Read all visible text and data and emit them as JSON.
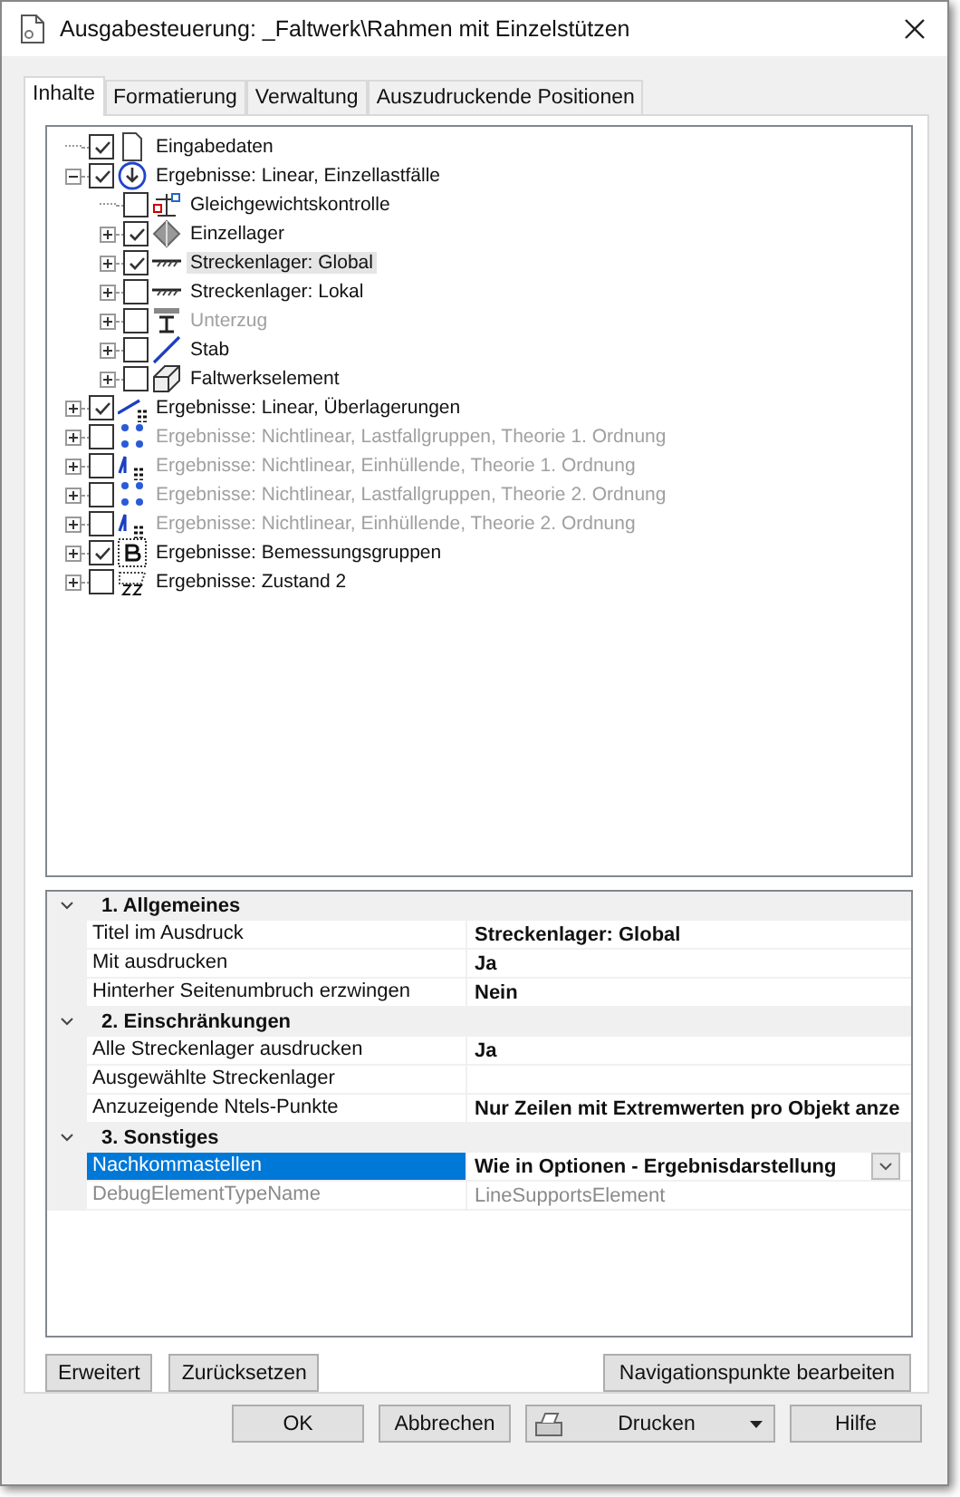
{
  "window": {
    "title": "Ausgabesteuerung: _Faltwerk\\Rahmen mit Einzelstützen"
  },
  "tabs": [
    {
      "label": "Inhalte",
      "selected": true
    },
    {
      "label": "Formatierung",
      "selected": false
    },
    {
      "label": "Verwaltung",
      "selected": false
    },
    {
      "label": "Auszudruckende Positionen",
      "selected": false
    }
  ],
  "tree": [
    {
      "label": "Eingabedaten",
      "kind": "document",
      "checked": true,
      "disabled": false,
      "selected": false
    },
    {
      "label": "Ergebnisse: Linear, Einzellastfälle",
      "kind": "result",
      "expanded": true,
      "checked": true,
      "disabled": false,
      "selected": false,
      "children": [
        {
          "label": "Gleichgewichtskontrolle",
          "kind": "balance",
          "checked": false,
          "disabled": false,
          "selected": false
        },
        {
          "label": "Einzellager",
          "kind": "support",
          "expanded": false,
          "checked": true,
          "disabled": false,
          "selected": false
        },
        {
          "label": "Streckenlager: Global",
          "kind": "linesupport",
          "expanded": false,
          "checked": true,
          "disabled": false,
          "selected": true
        },
        {
          "label": "Streckenlager: Lokal",
          "kind": "linesupport",
          "expanded": false,
          "checked": false,
          "disabled": false,
          "selected": false
        },
        {
          "label": "Unterzug",
          "kind": "beam",
          "expanded": false,
          "checked": false,
          "disabled": true,
          "selected": false
        },
        {
          "label": "Stab",
          "kind": "bar",
          "expanded": false,
          "checked": false,
          "disabled": false,
          "selected": false
        },
        {
          "label": "Faltwerkselement",
          "kind": "shell",
          "expanded": false,
          "checked": false,
          "disabled": false,
          "selected": false
        }
      ]
    },
    {
      "label": "Ergebnisse: Linear, Überlagerungen",
      "kind": "combination",
      "expanded": false,
      "checked": true,
      "disabled": false,
      "selected": false
    },
    {
      "label": "Ergebnisse: Nichtlinear, Lastfallgruppen, Theorie 1. Ordnung",
      "kind": "groups",
      "expanded": false,
      "checked": false,
      "disabled": true,
      "selected": false
    },
    {
      "label": "Ergebnisse: Nichtlinear, Einhüllende, Theorie 1. Ordnung",
      "kind": "envelope",
      "expanded": false,
      "checked": false,
      "disabled": true,
      "selected": false
    },
    {
      "label": "Ergebnisse: Nichtlinear, Lastfallgruppen, Theorie 2. Ordnung",
      "kind": "groups",
      "expanded": false,
      "checked": false,
      "disabled": true,
      "selected": false
    },
    {
      "label": "Ergebnisse: Nichtlinear, Einhüllende, Theorie 2. Ordnung",
      "kind": "envelope",
      "expanded": false,
      "checked": false,
      "disabled": true,
      "selected": false
    },
    {
      "label": "Ergebnisse: Bemessungsgruppen",
      "kind": "design",
      "expanded": false,
      "checked": true,
      "disabled": false,
      "selected": false
    },
    {
      "label": "Ergebnisse: Zustand 2",
      "kind": "state",
      "expanded": false,
      "checked": false,
      "disabled": false,
      "selected": false
    }
  ],
  "properties": [
    {
      "category": "1. Allgemeines",
      "expanded": true,
      "rows": [
        {
          "name": "Titel im Ausdruck",
          "value": "Streckenlager: Global",
          "selected": false,
          "disabled": false
        },
        {
          "name": "Mit ausdrucken",
          "value": "Ja",
          "selected": false,
          "disabled": false
        },
        {
          "name": "Hinterher Seitenumbruch erzwingen",
          "value": "Nein",
          "selected": false,
          "disabled": false
        }
      ]
    },
    {
      "category": "2. Einschränkungen",
      "expanded": true,
      "rows": [
        {
          "name": "Alle Streckenlager ausdrucken",
          "value": "Ja",
          "selected": false,
          "disabled": false
        },
        {
          "name": "Ausgewählte Streckenlager",
          "selected": false,
          "disabled": false
        },
        {
          "name": "Anzuzeigende Ntels-Punkte",
          "value": "Nur Zeilen mit Extremwerten pro Objekt anze",
          "selected": false,
          "disabled": false
        }
      ]
    },
    {
      "category": "3. Sonstiges",
      "expanded": true,
      "rows": [
        {
          "name": "Nachkommastellen",
          "value": "Wie in Optionen - Ergebnisdarstellung",
          "selected": true,
          "disabled": false
        },
        {
          "name": "DebugElementTypeName",
          "value": "LineSupportsElement",
          "selected": false,
          "disabled": true
        }
      ]
    }
  ],
  "panel_buttons": [
    "Erweitert",
    "Zurücksetzen",
    "Navigationspunkte bearbeiten"
  ],
  "dialog_buttons": [
    {
      "label": "OK",
      "kind": "plain"
    },
    {
      "label": "Abbrechen",
      "kind": "plain"
    },
    {
      "label": "Drucken",
      "kind": "print"
    },
    {
      "label": "Hilfe",
      "kind": "plain"
    }
  ]
}
